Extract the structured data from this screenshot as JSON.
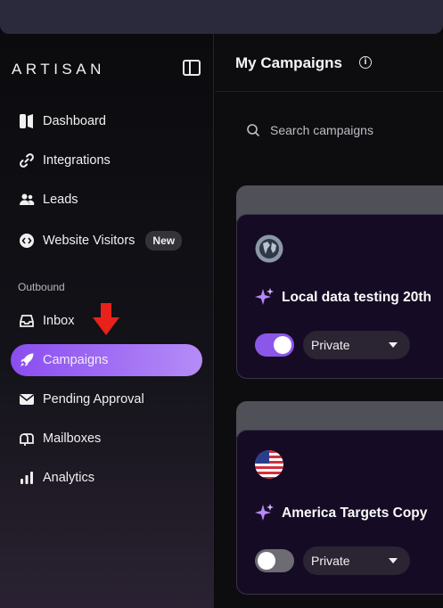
{
  "brand": {
    "logo_text": "ARTISAN"
  },
  "sidebar": {
    "items": [
      {
        "label": "Dashboard",
        "icon": "dashboard-icon"
      },
      {
        "label": "Integrations",
        "icon": "link-icon"
      },
      {
        "label": "Leads",
        "icon": "users-icon"
      },
      {
        "label": "Website Visitors",
        "icon": "code-icon",
        "badge": "New"
      }
    ],
    "section_label": "Outbound",
    "outbound_items": [
      {
        "label": "Inbox",
        "icon": "inbox-icon"
      },
      {
        "label": "Campaigns",
        "icon": "rocket-icon",
        "active": true
      },
      {
        "label": "Pending Approval",
        "icon": "mail-icon"
      },
      {
        "label": "Mailboxes",
        "icon": "mailbox-icon"
      },
      {
        "label": "Analytics",
        "icon": "bar-chart-icon"
      }
    ]
  },
  "main": {
    "title": "My Campaigns",
    "search_placeholder": "Search campaigns",
    "campaigns": [
      {
        "name": "Local data testing 20th",
        "flag": "globe-icon",
        "enabled": true,
        "visibility": "Private"
      },
      {
        "name": "America Targets Copy",
        "flag": "us-flag-icon",
        "enabled": false,
        "visibility": "Private"
      }
    ]
  },
  "colors": {
    "accent": "#8a4df0",
    "annotation_arrow": "#e8221b"
  }
}
